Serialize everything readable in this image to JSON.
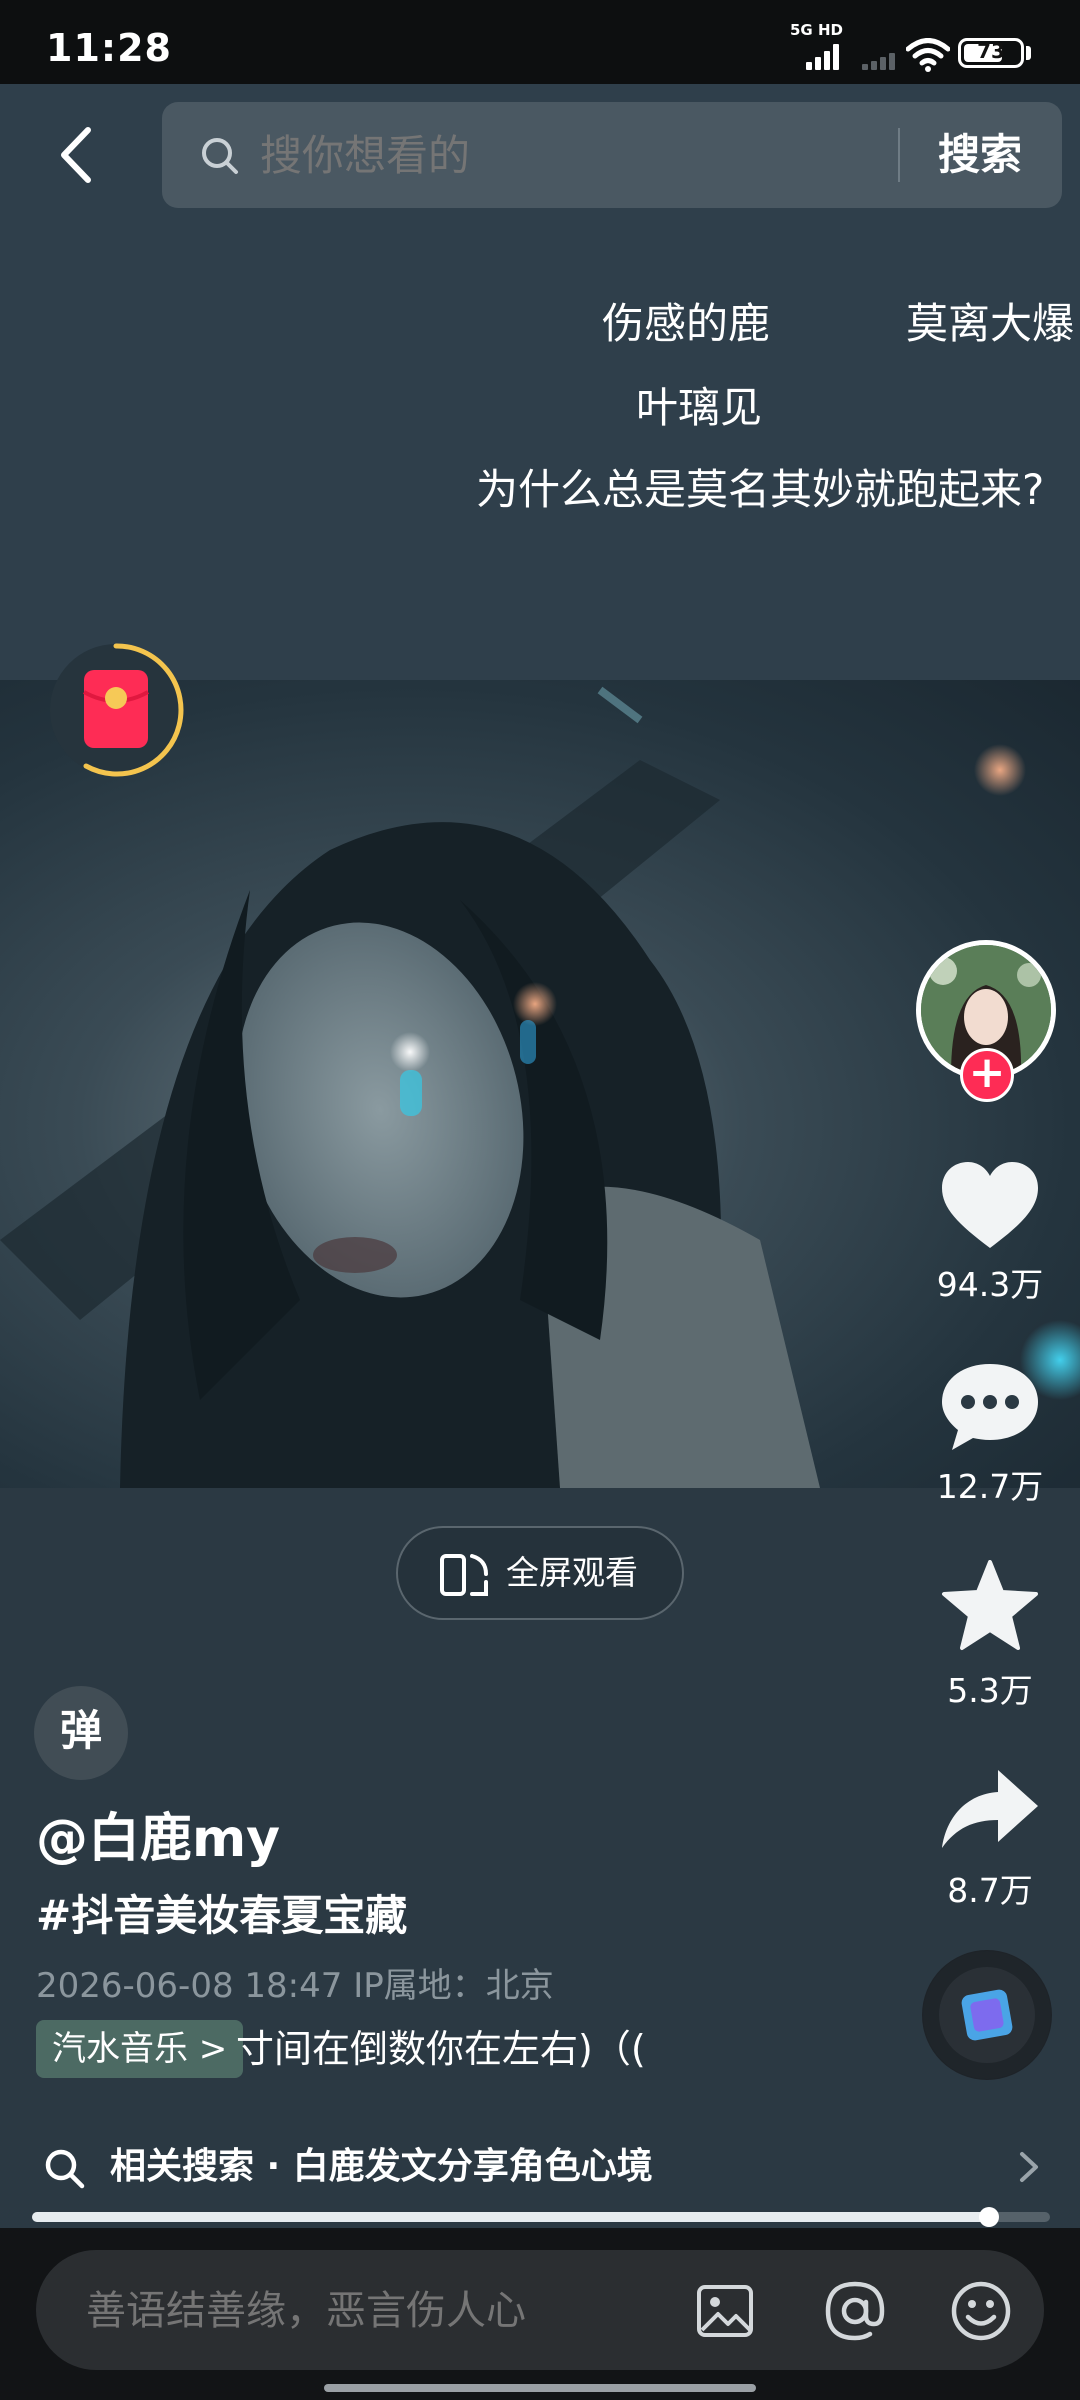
{
  "status_bar": {
    "time": "11:28",
    "network": "5G HD",
    "battery_level": "73"
  },
  "search": {
    "placeholder": "搜你想看的",
    "button_label": "搜索"
  },
  "danmaku": [
    "伤感的鹿",
    "莫离大爆",
    "叶璃见",
    "为什么总是莫名其妙就跑起来?"
  ],
  "actions": {
    "likes": "94.3万",
    "comments": "12.7万",
    "favorites": "5.3万",
    "shares": "8.7万"
  },
  "follow_label": "+",
  "fullscreen_label": "全屏观看",
  "danmu_toggle_label": "弹",
  "post": {
    "author": "@白鹿my",
    "hashtag": "#抖音美妆春夏宝藏",
    "meta": "2026-06-08 18:47  IP属地：北京",
    "music_tag": "汽水音乐 >",
    "music_title": "寸间在倒数你在左右)（("
  },
  "related_search": "相关搜索 · 白鹿发文分享角色心境",
  "progress": 0.94,
  "comment_placeholder": "善语结善缘，恶言伤人心",
  "colors": {
    "accent_red": "#fe2c55",
    "background": "#2e3d47",
    "progress_ring": "#f4c44e"
  },
  "icons": [
    "back-icon",
    "search-icon",
    "red-packet-icon",
    "heart-icon",
    "comment-icon",
    "star-icon",
    "share-icon",
    "fullscreen-icon",
    "image-icon",
    "at-icon",
    "emoji-icon",
    "chevron-right-icon"
  ]
}
